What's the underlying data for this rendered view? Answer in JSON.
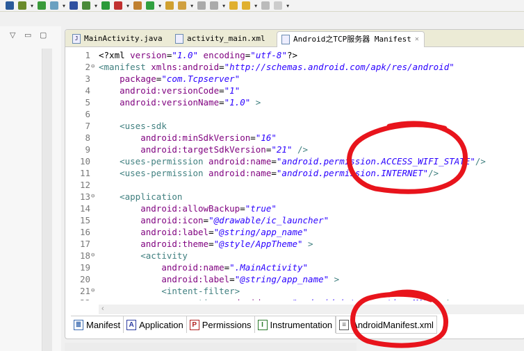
{
  "toolbar": {
    "icons": [
      "download-icon",
      "save-icon",
      "check-icon",
      "android-icon",
      "search-icon",
      "debug-icon",
      "run-icon",
      "stop-icon",
      "package-icon",
      "refresh-icon",
      "folder-icon",
      "wand-icon",
      "doc-icon",
      "up-icon",
      "back-icon",
      "forward-icon",
      "next-icon",
      "window-icon"
    ]
  },
  "tabs": [
    {
      "label": "MainActivity.java"
    },
    {
      "label": "activity_main.xml"
    },
    {
      "label": "Android之TCP服务器 Manifest",
      "close": "✕"
    }
  ],
  "code": [
    [
      [
        "p",
        "<?xml "
      ],
      [
        "a",
        "version"
      ],
      [
        "p",
        "="
      ],
      [
        "v",
        "\"1.0\""
      ],
      [
        "p",
        " "
      ],
      [
        "a",
        "encoding"
      ],
      [
        "p",
        "="
      ],
      [
        "v",
        "\"utf-8\""
      ],
      [
        "p",
        "?>"
      ]
    ],
    [
      [
        "t",
        "<manifest "
      ],
      [
        "a",
        "xmlns:android"
      ],
      [
        "p",
        "="
      ],
      [
        "v",
        "\"http://schemas.android.com/apk/res/android\""
      ]
    ],
    [
      [
        "p",
        "    "
      ],
      [
        "a",
        "package"
      ],
      [
        "p",
        "="
      ],
      [
        "v",
        "\"com.Tcpserver\""
      ]
    ],
    [
      [
        "p",
        "    "
      ],
      [
        "a",
        "android:versionCode"
      ],
      [
        "p",
        "="
      ],
      [
        "v",
        "\"1\""
      ]
    ],
    [
      [
        "p",
        "    "
      ],
      [
        "a",
        "android:versionName"
      ],
      [
        "p",
        "="
      ],
      [
        "v",
        "\"1.0\""
      ],
      [
        "t",
        " >"
      ]
    ],
    [],
    [
      [
        "p",
        "    "
      ],
      [
        "t",
        "<uses-sdk"
      ]
    ],
    [
      [
        "p",
        "        "
      ],
      [
        "a",
        "android:minSdkVersion"
      ],
      [
        "p",
        "="
      ],
      [
        "v",
        "\"16\""
      ]
    ],
    [
      [
        "p",
        "        "
      ],
      [
        "a",
        "android:targetSdkVersion"
      ],
      [
        "p",
        "="
      ],
      [
        "v",
        "\"21\""
      ],
      [
        "t",
        " />"
      ]
    ],
    [
      [
        "p",
        "    "
      ],
      [
        "t",
        "<uses-permission "
      ],
      [
        "a",
        "android:name"
      ],
      [
        "p",
        "="
      ],
      [
        "v",
        "\"android.permission.ACCESS_WIFI_STATE\""
      ],
      [
        "t",
        "/>"
      ]
    ],
    [
      [
        "p",
        "    "
      ],
      [
        "t",
        "<uses-permission "
      ],
      [
        "a",
        "android:name"
      ],
      [
        "p",
        "="
      ],
      [
        "v",
        "\"android.permission.INTERNET\""
      ],
      [
        "t",
        "/>"
      ]
    ],
    [],
    [
      [
        "p",
        "    "
      ],
      [
        "t",
        "<application"
      ]
    ],
    [
      [
        "p",
        "        "
      ],
      [
        "a",
        "android:allowBackup"
      ],
      [
        "p",
        "="
      ],
      [
        "v",
        "\"true\""
      ]
    ],
    [
      [
        "p",
        "        "
      ],
      [
        "a",
        "android:icon"
      ],
      [
        "p",
        "="
      ],
      [
        "v",
        "\"@drawable/ic_launcher\""
      ]
    ],
    [
      [
        "p",
        "        "
      ],
      [
        "a",
        "android:label"
      ],
      [
        "p",
        "="
      ],
      [
        "v",
        "\"@string/app_name\""
      ]
    ],
    [
      [
        "p",
        "        "
      ],
      [
        "a",
        "android:theme"
      ],
      [
        "p",
        "="
      ],
      [
        "v",
        "\"@style/AppTheme\""
      ],
      [
        "t",
        " >"
      ]
    ],
    [
      [
        "p",
        "        "
      ],
      [
        "t",
        "<activity"
      ]
    ],
    [
      [
        "p",
        "            "
      ],
      [
        "a",
        "android:name"
      ],
      [
        "p",
        "="
      ],
      [
        "v",
        "\".MainActivity\""
      ]
    ],
    [
      [
        "p",
        "            "
      ],
      [
        "a",
        "android:label"
      ],
      [
        "p",
        "="
      ],
      [
        "v",
        "\"@string/app_name\""
      ],
      [
        "t",
        " >"
      ]
    ],
    [
      [
        "p",
        "            "
      ],
      [
        "t",
        "<intent-filter>"
      ]
    ],
    [
      [
        "p",
        "                "
      ],
      [
        "t",
        "<action "
      ],
      [
        "a",
        "android:name"
      ],
      [
        "p",
        "="
      ],
      [
        "v",
        "\"android.intent.action.MAIN\""
      ],
      [
        "t",
        " />"
      ]
    ]
  ],
  "folds": [
    2,
    13,
    18,
    21
  ],
  "bottom_tabs": [
    {
      "label": "Manifest",
      "icon": "≣"
    },
    {
      "label": "Application",
      "icon": "A"
    },
    {
      "label": "Permissions",
      "icon": "P"
    },
    {
      "label": "Instrumentation",
      "icon": "I"
    },
    {
      "label": "AndroidManifest.xml",
      "icon": "≡"
    }
  ],
  "colors": {
    "tag": "#3f7f7f",
    "attr": "#7f007f",
    "value": "#2a00ff",
    "annotation": "#e8141c"
  }
}
